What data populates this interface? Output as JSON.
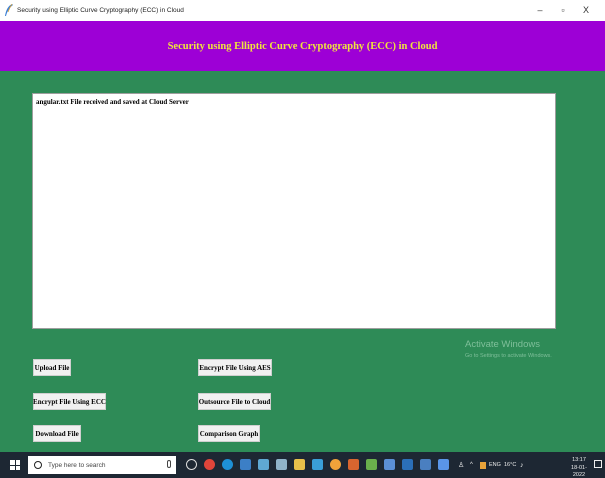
{
  "window": {
    "title": "Security using Elliptic Curve Cryptography (ECC) in Cloud",
    "minimize": "–",
    "maximize": "▫",
    "close": "X"
  },
  "header": {
    "text": "Security using Elliptic Curve Cryptography (ECC) in Cloud"
  },
  "output": {
    "lines": [
      "angular.txt File received and saved at Cloud Server"
    ]
  },
  "buttons": {
    "upload": "Upload File",
    "encrypt_ecc": "Encrypt File Using ECC",
    "download": "Download File",
    "encrypt_aes": "Encrypt File Using AES",
    "outsource": "Outsource File to Cloud",
    "comparison": "Comparison Graph"
  },
  "watermark": {
    "title": "Activate Windows",
    "subtitle": "Go to Settings to activate Windows."
  },
  "taskbar": {
    "search_placeholder": "Type here to search",
    "time": "13:17",
    "date": "18-01-2022",
    "lang": "ENG",
    "temp": "16°C"
  },
  "colors": {
    "header_bg": "#9d00d6",
    "header_text": "#f0e43c",
    "body_bg": "#2e8b57",
    "taskbar_bg": "#1d2733"
  }
}
